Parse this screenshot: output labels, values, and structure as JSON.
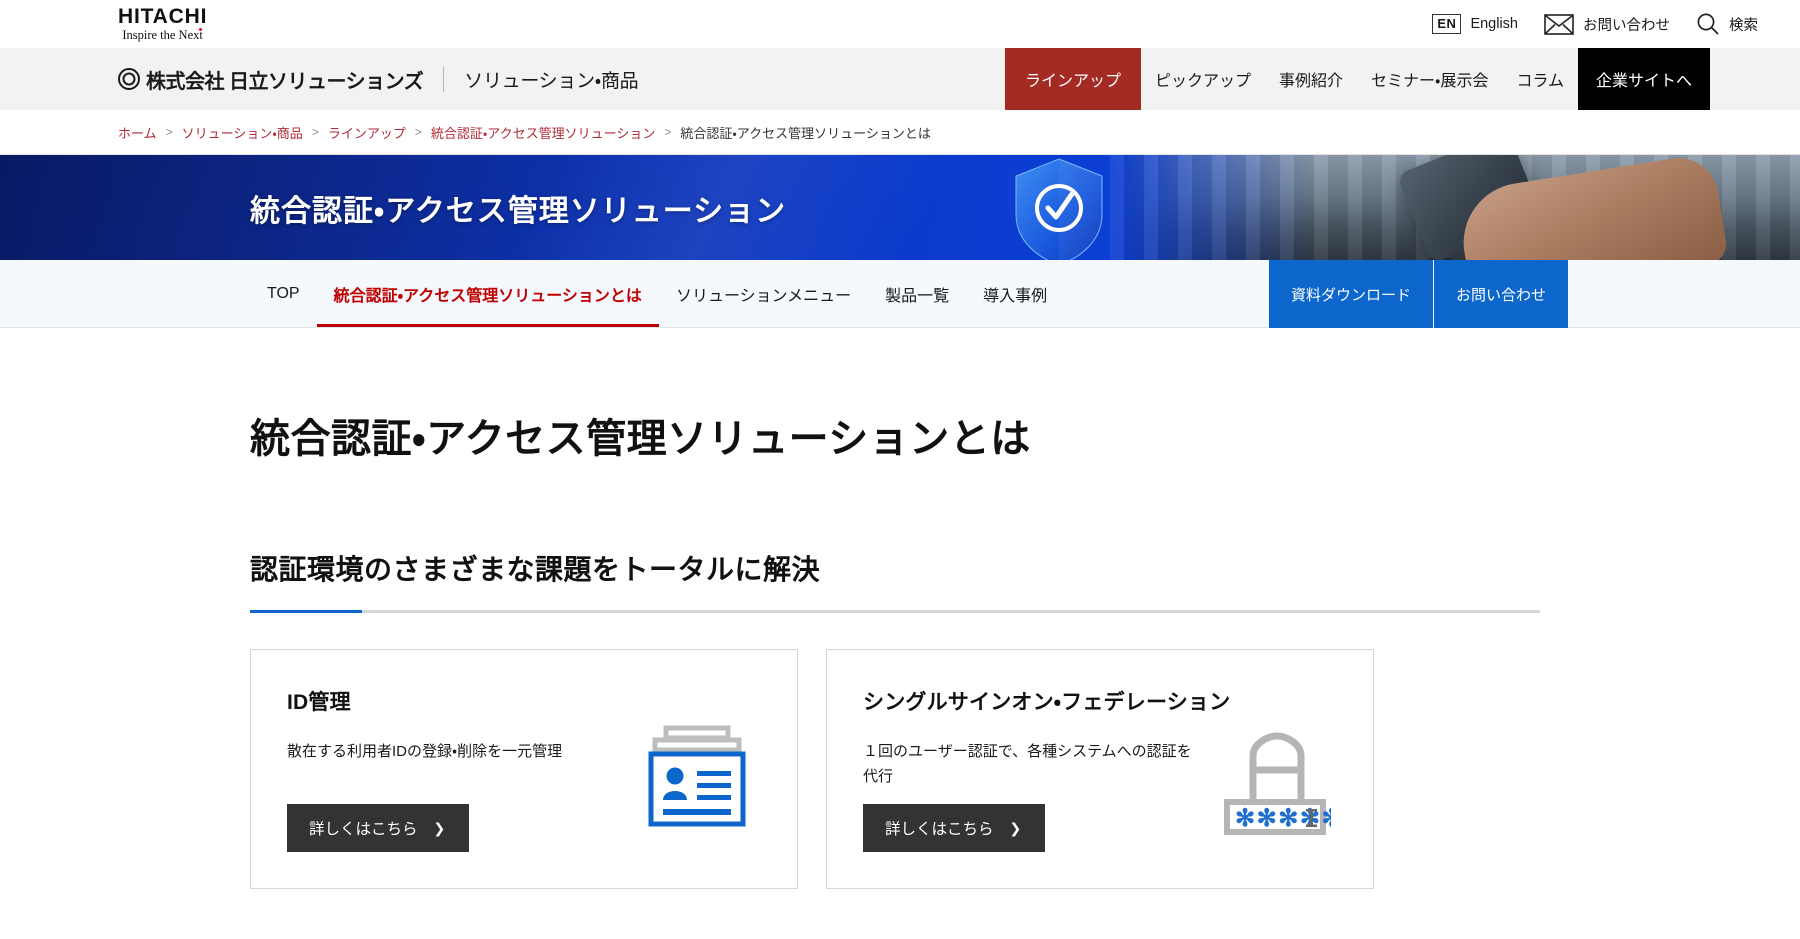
{
  "utility": {
    "logo_word": "HITACHI",
    "logo_tagline": "Inspire the Next",
    "lang_badge": "EN",
    "lang_label": "English",
    "contact_label": "お問い合わせ",
    "search_label": "検索"
  },
  "global_nav": {
    "brand_company": "株式会社 日立ソリューションズ",
    "brand_section": "ソリューション・商品",
    "items": [
      {
        "label": "ラインアップ",
        "state": "active"
      },
      {
        "label": "ピックアップ",
        "state": "default"
      },
      {
        "label": "事例紹介",
        "state": "default"
      },
      {
        "label": "セミナー・展示会",
        "state": "default"
      },
      {
        "label": "コラム",
        "state": "default"
      },
      {
        "label": "企業サイトへ",
        "state": "corporate"
      }
    ]
  },
  "breadcrumb": {
    "separator": ">",
    "items": [
      {
        "label": "ホーム",
        "current": false
      },
      {
        "label": "ソリューション・商品",
        "current": false
      },
      {
        "label": "ラインアップ",
        "current": false
      },
      {
        "label": "統合認証・アクセス管理ソリューション",
        "current": false
      },
      {
        "label": "統合認証・アクセス管理ソリューションとは",
        "current": true
      }
    ]
  },
  "hero": {
    "title": "統合認証・アクセス管理ソリューション"
  },
  "local_nav": {
    "tabs": [
      {
        "label": "TOP",
        "active": false
      },
      {
        "label": "統合認証・アクセス管理ソリューションとは",
        "active": true
      },
      {
        "label": "ソリューションメニュー",
        "active": false
      },
      {
        "label": "製品一覧",
        "active": false
      },
      {
        "label": "導入事例",
        "active": false
      }
    ],
    "cta": [
      {
        "label": "資料ダウンロード"
      },
      {
        "label": "お問い合わせ"
      }
    ]
  },
  "main": {
    "page_title": "統合認証・アクセス管理ソリューションとは",
    "section_title": "認証環境のさまざまな課題をトータルに解決",
    "cards": [
      {
        "title": "ID管理",
        "description": "散在する利用者IDの登録・削除を一元管理",
        "button_label": "詳しくはこちら",
        "button_chevron": "❯",
        "icon": "id-card-icon"
      },
      {
        "title": "シングルサインオン・フェデレーション",
        "description": "１回のユーザー認証で、各種システムへの認証を代行",
        "button_label": "詳しくはこちら",
        "button_chevron": "❯",
        "icon": "padlock-password-icon",
        "password_mask": "✻✻✻✻✻"
      }
    ]
  },
  "colors": {
    "accent_red": "#c00000",
    "nav_active_red": "#a42b23",
    "link_red": "#b02a37",
    "brand_blue": "#0c66cb",
    "hero_blue": "#0c3fd6",
    "dark_button": "#333333"
  }
}
